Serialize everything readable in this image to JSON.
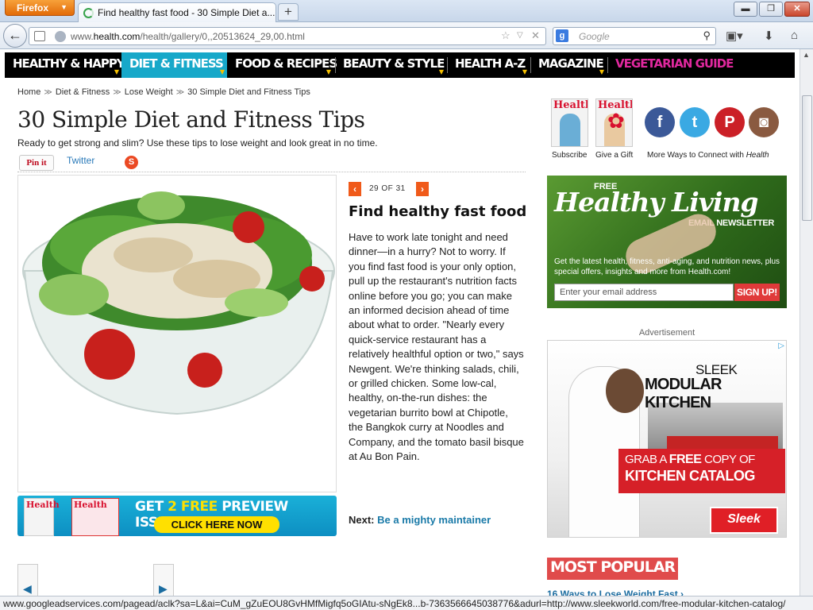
{
  "browser": {
    "menu_label": "Firefox",
    "tab_title": "Find healthy fast food - 30 Simple Diet a...",
    "newtab_label": "+",
    "url_prefix": "www.",
    "url_domain": "health.com",
    "url_path": "/health/gallery/0,,20513624_29,00.html",
    "search_placeholder": "Google",
    "status_text": "www.googleadservices.com/pagead/aclk?sa=L&ai=CuM_gZuEOU8GvHMfMigfq5oGIAtu-sNgEk8...b-7363566645038776&adurl=http://www.sleekworld.com/free-modular-kitchen-catalog/"
  },
  "nav": {
    "items": [
      {
        "label": "HEALTHY & HAPPY"
      },
      {
        "label": "DIET & FITNESS"
      },
      {
        "label": "FOOD & RECIPES"
      },
      {
        "label": "BEAUTY & STYLE"
      },
      {
        "label": "HEALTH A-Z"
      },
      {
        "label": "MAGAZINE"
      },
      {
        "label": "VEGETARIAN GUIDE"
      }
    ],
    "active_color": "#17a8c9",
    "veg_color": "#e0289e"
  },
  "breadcrumb": [
    "Home",
    "Diet & Fitness",
    "Lose Weight",
    "30 Simple Diet and Fitness Tips"
  ],
  "breadcrumb_sep": "≫",
  "gallery": {
    "title": "30 Simple Diet and Fitness Tips",
    "subtitle": "Ready to get strong and slim? Use these tips to lose weight and look great in no time.",
    "pinit_label": "Pin it",
    "twitter_label": "Twitter",
    "counter": "29 OF 31",
    "slide_title": "Find healthy fast food",
    "slide_body": "Have to work late tonight and need dinner—in a hurry? Not to worry. If you find fast food is your only option, pull up the restaurant's nutrition facts online before you go; you can make an informed decision ahead of time about what to order. \"Nearly every quick-service restaurant has a relatively healthful option or two,\" says Newgent. We're thinking salads, chili, or grilled chicken. Some low-cal, healthy, on-the-run dishes: the vegetarian burrito bowl at Chipotle, the Bangkok curry at Noodles and Company, and the tomato basil bisque at Au Bon Pain.",
    "next_label": "Next:",
    "next_link": "Be a mighty maintainer"
  },
  "promo": {
    "mag_logo": "Health",
    "headline_a": "GET ",
    "headline_b": "2 FREE",
    "headline_c": " PREVIEW ISSUES!",
    "cta": "CLICK HERE NOW"
  },
  "rail": {
    "subscribe_label": "Subscribe",
    "gift_label": "Give a Gift",
    "connect_prefix": "More Ways to Connect with ",
    "connect_brand": "Health",
    "social": [
      {
        "icon": "facebook-icon",
        "glyph": "f",
        "color": "#3b5998"
      },
      {
        "icon": "twitter-icon",
        "glyph": "t",
        "color": "#3aa9e3"
      },
      {
        "icon": "pinterest-icon",
        "glyph": "P",
        "color": "#cb2027"
      },
      {
        "icon": "instagram-icon",
        "glyph": "◙",
        "color": "#8a5a40"
      }
    ]
  },
  "newsletter": {
    "free": "FREE",
    "headline": "Healthy Living",
    "label": "EMAIL NEWSLETTER",
    "desc": "Get the latest health, fitness, anti-aging, and nutrition news, plus special offers, insights and more from Health.com!",
    "email_placeholder": "Enter your email address",
    "signup": "SIGN UP!"
  },
  "ad": {
    "label": "Advertisement",
    "choices": "▷",
    "line1": "SLEEK",
    "line2": "MODULAR KITCHEN",
    "grab": "GRAB A ",
    "free": "FREE",
    "copy": " COPY OF",
    "catalog": "KITCHEN CATALOG",
    "logo": "Sleek"
  },
  "most_popular": {
    "title": "MOST POPULAR",
    "first_item": "16 Ways to Lose Weight Fast ›"
  }
}
